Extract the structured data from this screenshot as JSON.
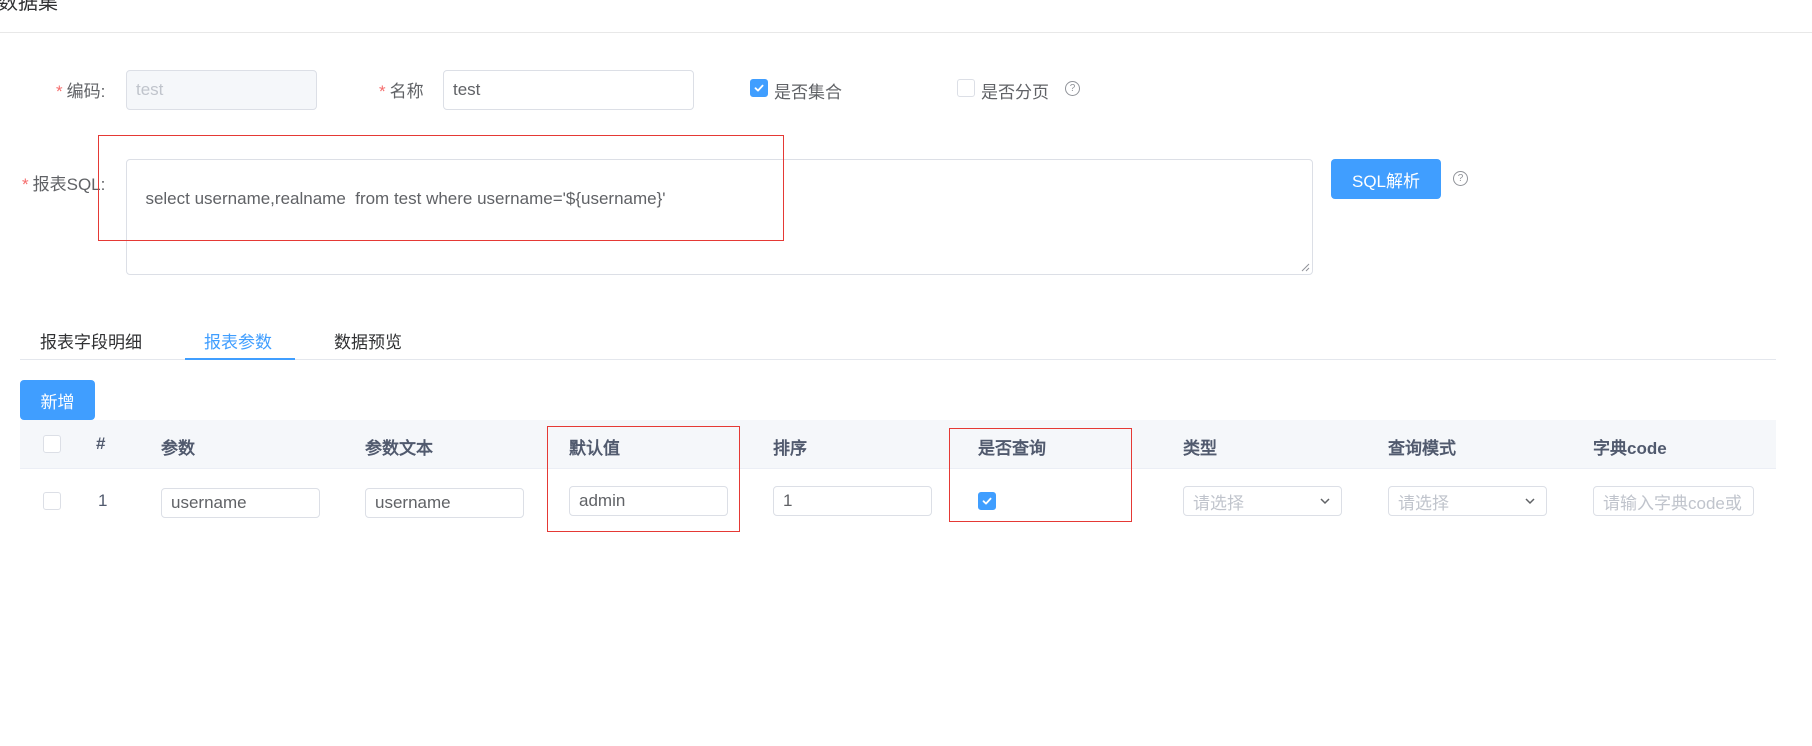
{
  "page": {
    "title": "数据集"
  },
  "form": {
    "code": {
      "label": "编码:",
      "value": "test"
    },
    "name": {
      "label": "名称",
      "value": "test"
    },
    "is_collection": {
      "label": "是否集合",
      "checked": true
    },
    "is_paged": {
      "label": "是否分页",
      "checked": false
    },
    "sql": {
      "label": "报表SQL:",
      "value": "select username,realname  from test where username='${username}'"
    },
    "sql_parse_button": "SQL解析",
    "required_mark": "*",
    "help_glyph": "?"
  },
  "tabs": [
    {
      "label": "报表字段明细",
      "active": false
    },
    {
      "label": "报表参数",
      "active": true
    },
    {
      "label": "数据预览",
      "active": false
    }
  ],
  "toolbar": {
    "add_button": "新增"
  },
  "table": {
    "headers": [
      "#",
      "参数",
      "参数文本",
      "默认值",
      "排序",
      "是否查询",
      "类型",
      "查询模式",
      "字典code"
    ],
    "rows": [
      {
        "index": "1",
        "param": "username",
        "param_text": "username",
        "default_value": "admin",
        "order": "1",
        "is_query": true,
        "type_placeholder": "请选择",
        "mode_placeholder": "请选择",
        "dict_placeholder": "请输入字典code或"
      }
    ]
  },
  "colors": {
    "primary": "#409eff",
    "required": "#f56c6c",
    "highlight": "#e53935"
  }
}
